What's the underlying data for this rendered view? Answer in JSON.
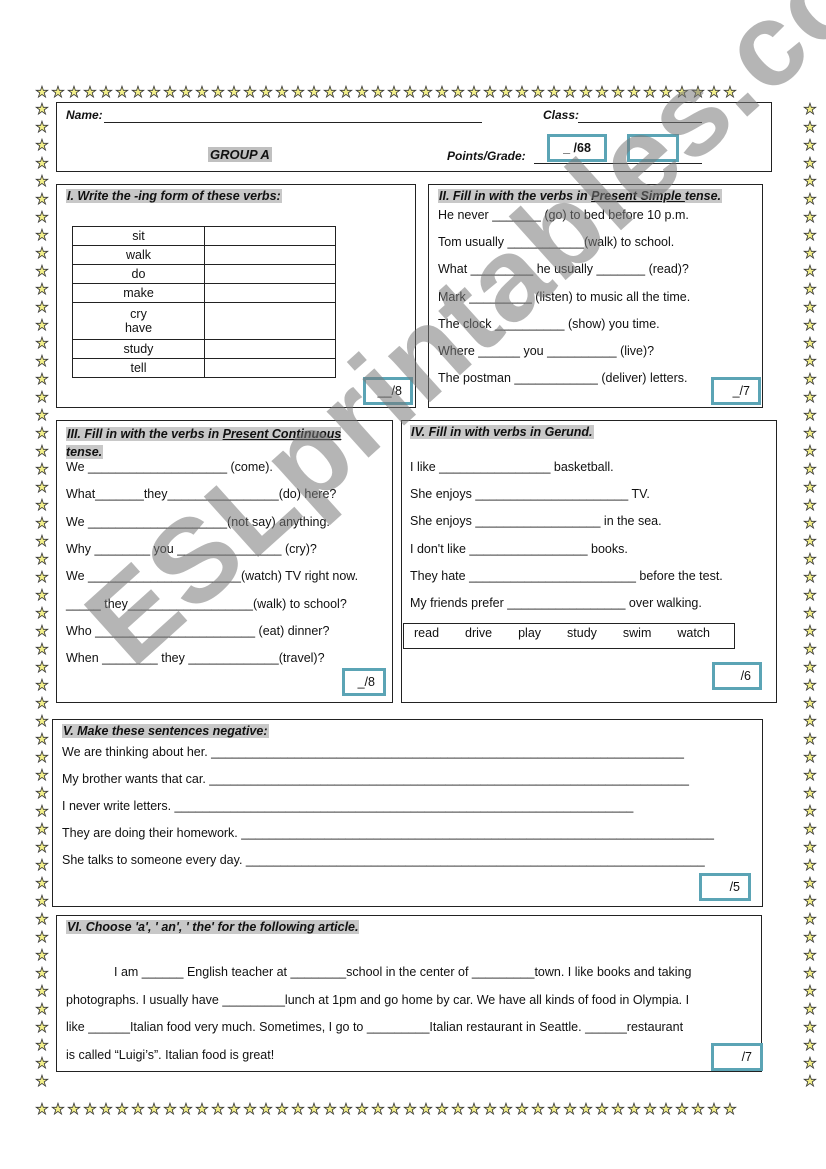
{
  "header": {
    "name_label": "Name:",
    "class_label": "Class:",
    "group": "GROUP A",
    "points_label": "Points/Grade:",
    "points_value": "_  /68",
    "grade_value": ""
  },
  "section1": {
    "title": "I. Write the  -ing form of these verbs:",
    "verbs": [
      "sit",
      "walk",
      "do",
      "make",
      "cry\nhave",
      "study",
      "tell"
    ],
    "score": "__/8"
  },
  "section2": {
    "title_prefix": "II. Fill in with the verbs in ",
    "title_underlined": "Present Simple ",
    "title_suffix": "tense.",
    "sentences": [
      "He never _______ (go) to bed before 10 p.m.",
      "Tom usually ___________(walk) to school.",
      "What _________ he usually _______ (read)?",
      "Mark _________ (listen) to music all the time.",
      "The clock __________ (show) you time.",
      "Where ______ you __________ (live)?",
      "The postman ____________ (deliver) letters."
    ],
    "score": "_/7"
  },
  "section3": {
    "title_prefix": "III. Fill in with the verbs in ",
    "title_underlined": "Present Continuous",
    "title_suffix": "tense.",
    "sentences": [
      "We ____________________ (come).",
      "What_______they________________(do) here?",
      "We ____________________(not say) anything.",
      "Why ________ you _______________ (cry)?",
      "We ______________________(watch)  TV right now.",
      "_____ they__________________(walk) to school?",
      "Who _______________________ (eat) dinner?",
      "When ________ they _____________(travel)?"
    ],
    "score": "_/8"
  },
  "section4": {
    "title": "IV. Fill in with verbs in Gerund.",
    "sentences": [
      "I like ________________ basketball.",
      " She enjoys ______________________ TV.",
      "She enjoys __________________ in the sea.",
      "I don't like _________________ books.",
      "They hate ________________________ before the test.",
      "My friends prefer _________________ over walking."
    ],
    "word_bank": [
      "read",
      "drive",
      "play",
      "study",
      "swim",
      "watch"
    ],
    "score": "/6"
  },
  "section5": {
    "title": "V. Make these sentences negative:",
    "sentences": [
      "We are thinking about her. ____________________________________________________________________",
      "My brother wants that car. _____________________________________________________________________",
      "I never write letters. __________________________________________________________________",
      "They are doing their homework. ____________________________________________________________________",
      "She talks to someone every day. __________________________________________________________________"
    ],
    "score": "/5"
  },
  "section6": {
    "title": "VI. Choose  'a', ' an', ' the' for the following article.",
    "lines": [
      "I am  ______ English teacher at ________school in the center of _________town. I like books and taking",
      "photographs. I usually have _________lunch at 1pm and go home by car. We have all kinds of food in Olympia. I",
      "like ______Italian food very much. Sometimes, I go to _________Italian restaurant in Seattle. ______restaurant",
      "is called “Luigi’s”. Italian food is great!"
    ],
    "score": "/7"
  },
  "watermark": "ESLprintables.com",
  "border_icon": "star-icon"
}
